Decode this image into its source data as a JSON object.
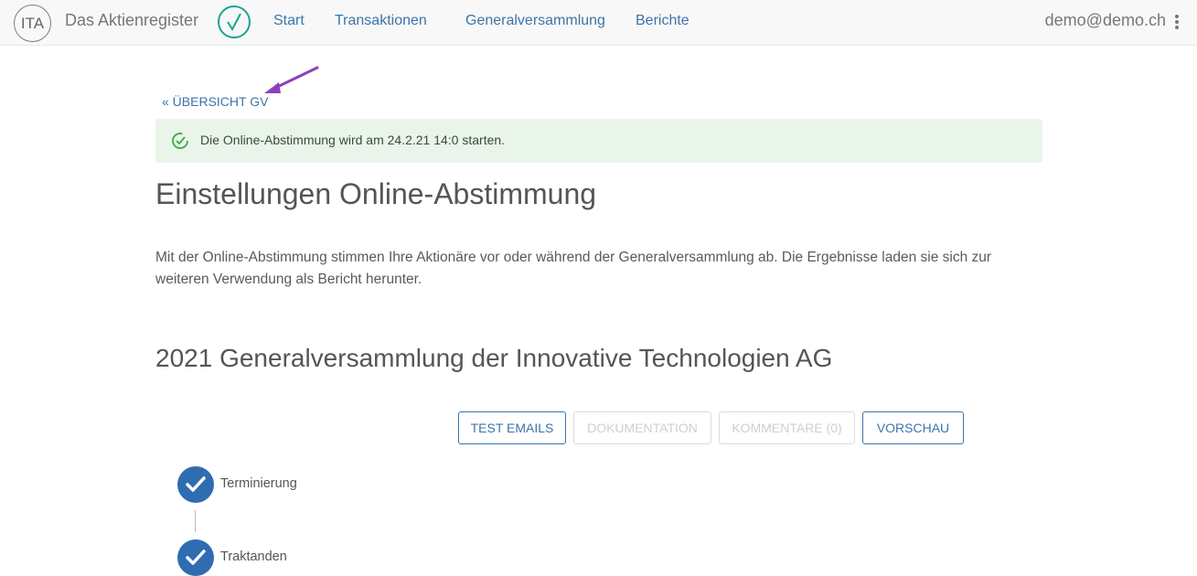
{
  "colors": {
    "link": "#3b75a8",
    "success": "#4caf50",
    "step": "#2f6db0",
    "accent_arrow": "#8e3fbf"
  },
  "header": {
    "logo_text": "ITA",
    "brand": "Das Aktienregister",
    "nav": [
      "Start",
      "Transaktionen",
      "Generalversammlung",
      "Berichte"
    ],
    "user": "demo@demo.ch"
  },
  "main": {
    "back_link": "« ÜBERSICHT GV",
    "alert": "Die Online-Abstimmung wird am 24.2.21 14:0 starten.",
    "page_title": "Einstellungen Online-Abstimmung",
    "intro_line1": "Mit der Online-Abstimmung stimmen Ihre Aktionäre vor oder während der Generalversammlung ab. Die Ergebnisse laden sie sich zur",
    "intro_line2": "weiteren Verwendung als Bericht herunter.",
    "event_title": "2021 Generalversammlung der Innovative Technologien AG",
    "buttons": {
      "test_emails": "TEST EMAILS",
      "dokumentation": "DOKUMENTATION",
      "kommentare": "KOMMENTARE (0)",
      "vorschau": "VORSCHAU"
    },
    "steps": [
      {
        "label": "Terminierung",
        "icon": "check-icon"
      },
      {
        "label": "Traktanden",
        "icon": "check-icon"
      }
    ]
  }
}
